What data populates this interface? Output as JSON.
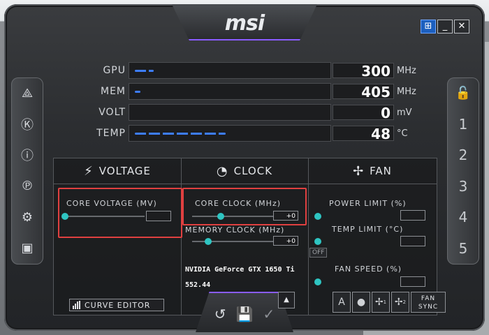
{
  "app": {
    "logo": "msi"
  },
  "window_buttons": {
    "windows": "⊞",
    "minimize": "_",
    "close": "✕"
  },
  "left_sidebar": [
    {
      "icon": "kombustor-icon",
      "glyph": "⟁"
    },
    {
      "icon": "k-boost-icon",
      "glyph": "Ⓚ"
    },
    {
      "icon": "info-icon",
      "glyph": "ⓘ"
    },
    {
      "icon": "oc-scanner-icon",
      "glyph": "℗"
    },
    {
      "icon": "settings-gear-icon",
      "glyph": "⚙"
    },
    {
      "icon": "monitor-icon",
      "glyph": "▣"
    }
  ],
  "right_sidebar": {
    "lock_glyph": "🔓",
    "profiles": [
      "1",
      "2",
      "3",
      "4",
      "5"
    ]
  },
  "stats": [
    {
      "label": "GPU",
      "value": "300",
      "unit": "MHz",
      "fill": 0.1
    },
    {
      "label": "MEM",
      "value": "405",
      "unit": "MHz",
      "fill": 0.03
    },
    {
      "label": "VOLT",
      "value": "0",
      "unit": "mV",
      "fill": 0
    },
    {
      "label": "TEMP",
      "value": "48",
      "unit": "°C",
      "fill": 0.48
    }
  ],
  "voltage": {
    "title": "VOLTAGE",
    "core_voltage_label": "CORE VOLTAGE  (MV)",
    "core_voltage_value": "",
    "curve_editor": "CURVE EDITOR"
  },
  "clock": {
    "title": "CLOCK",
    "core_clock_label": "CORE CLOCK (MHz)",
    "core_clock_value": "+0",
    "memory_clock_label": "MEMORY CLOCK (MHz)",
    "memory_clock_value": "+0",
    "gpu_name": "NVIDIA GeForce GTX 1650 Ti",
    "driver": "552.44"
  },
  "fan": {
    "title": "FAN",
    "power_limit_label": "POWER LIMIT (%)",
    "temp_limit_label": "TEMP LIMIT (°C)",
    "off_label": "OFF",
    "fan_speed_label": "FAN SPEED (%)",
    "fan_sync": "FAN SYNC",
    "fan1_sub": "1",
    "fan2_sub": "2"
  },
  "bottom": {
    "reset": "↺",
    "save": "💾",
    "apply": "✓",
    "up": "▲"
  },
  "colors": {
    "accent": "#2ec5c2",
    "highlight": "#e04040",
    "bar": "#3d7dff",
    "purple": "#8a5cff"
  }
}
